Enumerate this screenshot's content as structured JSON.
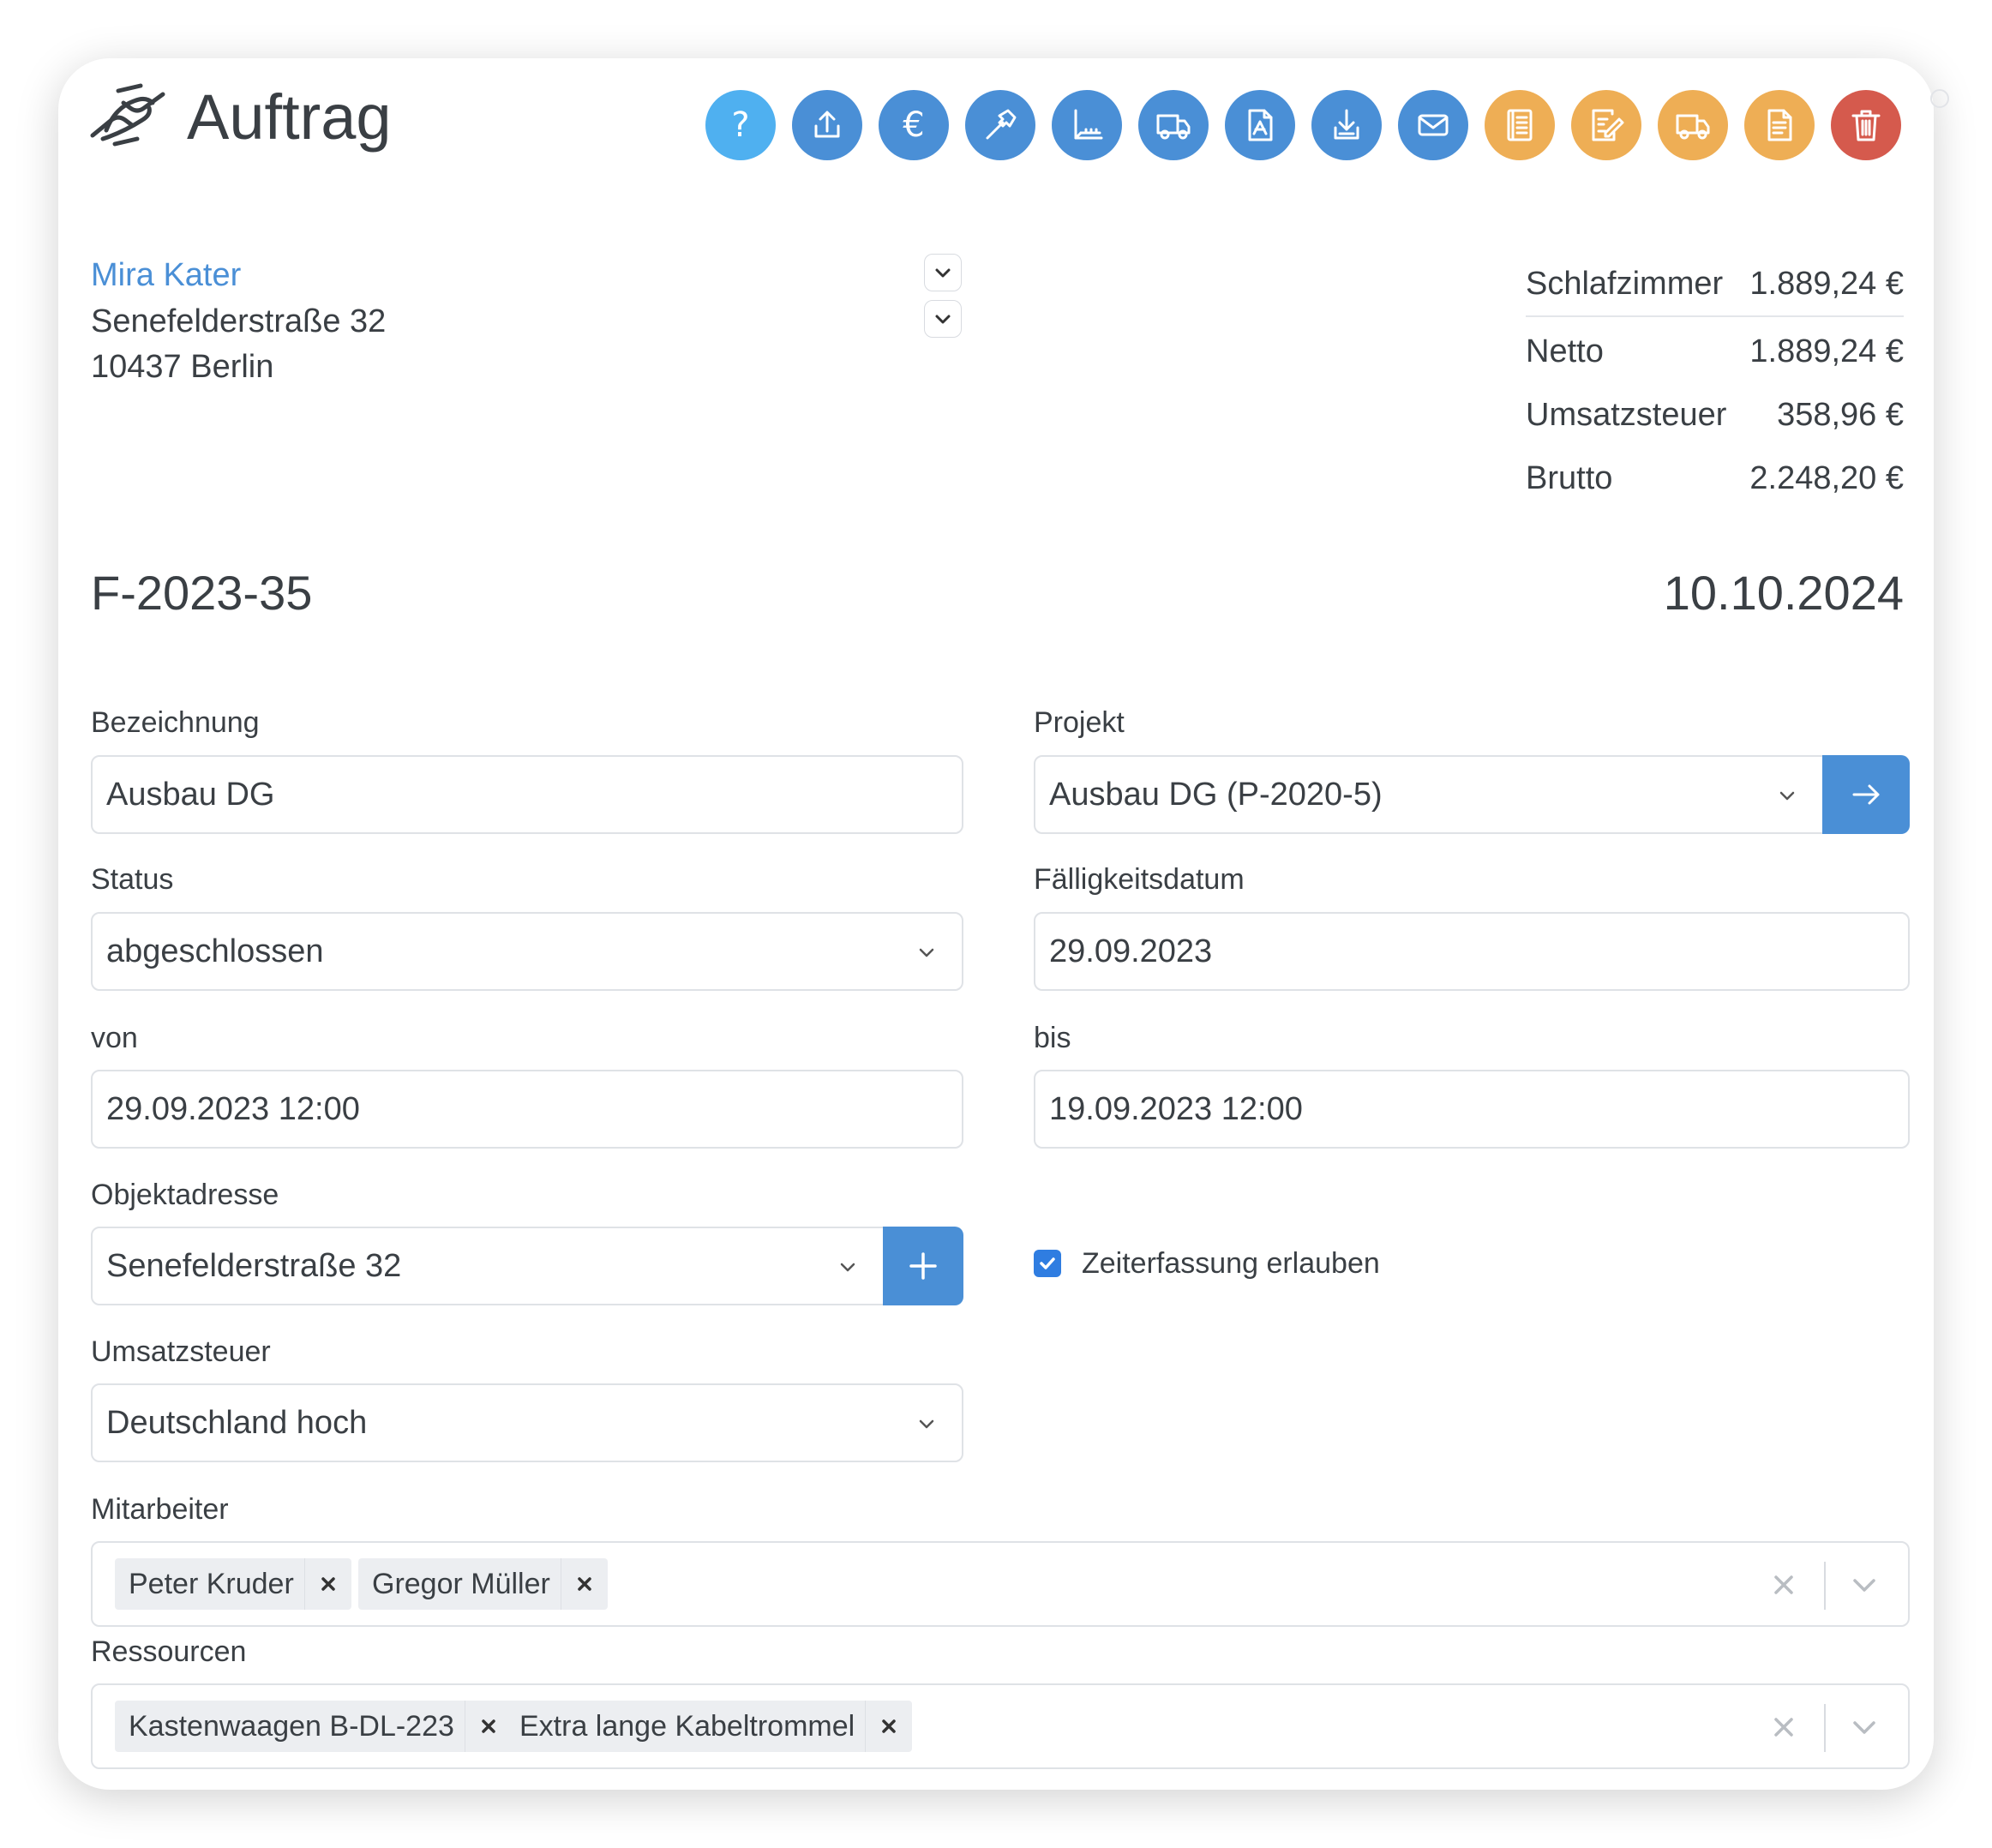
{
  "header": {
    "title": "Auftrag",
    "toolbar": [
      {
        "icon": "help-icon",
        "glyph": "?",
        "color": "light"
      },
      {
        "icon": "upload-icon",
        "color": "blue"
      },
      {
        "icon": "euro-icon",
        "glyph": "€",
        "color": "blue"
      },
      {
        "icon": "hammer-icon",
        "color": "blue"
      },
      {
        "icon": "measure-icon",
        "color": "blue"
      },
      {
        "icon": "truck-icon",
        "color": "blue"
      },
      {
        "icon": "pdf-icon",
        "color": "blue"
      },
      {
        "icon": "download-icon",
        "color": "blue"
      },
      {
        "icon": "mail-icon",
        "color": "blue"
      },
      {
        "icon": "document-icon",
        "color": "orange"
      },
      {
        "icon": "edit-document-icon",
        "color": "orange"
      },
      {
        "icon": "delivery-note-icon",
        "color": "orange"
      },
      {
        "icon": "invoice-icon",
        "color": "orange"
      },
      {
        "icon": "trash-icon",
        "color": "red"
      }
    ]
  },
  "customer": {
    "name": "Mira Kater",
    "street": "Senefelderstraße 32",
    "city": "10437 Berlin"
  },
  "totals": {
    "group_label": "Schlafzimmer",
    "group_value": "1.889,24 €",
    "netto_label": "Netto",
    "netto_value": "1.889,24 €",
    "tax_label": "Umsatzsteuer",
    "tax_value": "358,96 €",
    "brutto_label": "Brutto",
    "brutto_value": "2.248,20 €"
  },
  "document": {
    "number": "F-2023-35",
    "date": "10.10.2024"
  },
  "form": {
    "bezeichnung_label": "Bezeichnung",
    "bezeichnung_value": "Ausbau DG",
    "projekt_label": "Projekt",
    "projekt_value": "Ausbau DG (P-2020-5)",
    "status_label": "Status",
    "status_value": "abgeschlossen",
    "faellig_label": "Fälligkeitsdatum",
    "faellig_value": "29.09.2023",
    "von_label": "von",
    "von_value": "29.09.2023 12:00",
    "bis_label": "bis",
    "bis_value": "19.09.2023 12:00",
    "objekt_label": "Objektadresse",
    "objekt_value": "Senefelderstraße 32",
    "zeiterfassung_label": "Zeiterfassung erlauben",
    "zeiterfassung_checked": true,
    "ust_label": "Umsatzsteuer",
    "ust_value": "Deutschland hoch",
    "mitarbeiter_label": "Mitarbeiter",
    "mitarbeiter": [
      "Peter Kruder",
      "Gregor Müller"
    ],
    "ressourcen_label": "Ressourcen",
    "ressourcen": [
      "Kastenwaagen B-DL-223",
      "Extra lange Kabeltrommel"
    ]
  },
  "colors": {
    "accent": "#4a8fd6",
    "light_blue": "#4fb0f0",
    "orange": "#eeae55",
    "red": "#d55a4d",
    "link": "#4a8fd6"
  }
}
